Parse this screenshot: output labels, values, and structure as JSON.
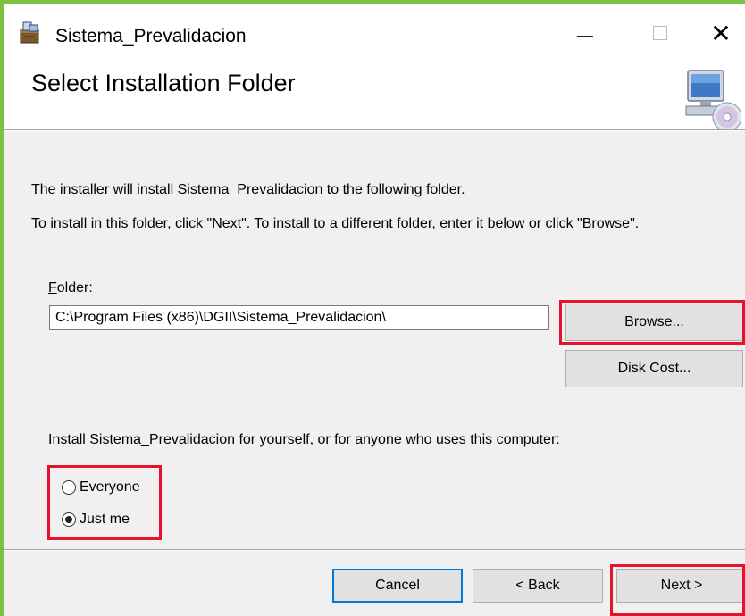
{
  "window": {
    "title": "Sistema_Prevalidacion",
    "minimize_glyph": "",
    "close_glyph": "✕",
    "app_icon": "installer-package-icon"
  },
  "header": {
    "title": "Select Installation Folder",
    "icon": "computer-disc-icon"
  },
  "body": {
    "description_1": "The installer will install Sistema_Prevalidacion to the following folder.",
    "description_2": "To install in this folder, click \"Next\". To install to a different folder, enter it below or click \"Browse\".",
    "folder_label_accel": "F",
    "folder_label_rest": "older:",
    "folder_value": "C:\\Program Files (x86)\\DGII\\Sistema_Prevalidacion\\",
    "browse_label": "Browse...",
    "disk_cost_label": "Disk Cost...",
    "install_for_text": "Install Sistema_Prevalidacion for yourself, or for anyone who uses this computer:",
    "radio_options": [
      {
        "label": "Everyone",
        "selected": false
      },
      {
        "label": "Just me",
        "selected": true
      }
    ]
  },
  "footer": {
    "cancel_label": "Cancel",
    "back_label": "< Back",
    "next_label": "Next >"
  },
  "colors": {
    "frame_accent": "#7cc242",
    "highlight": "#e8112d",
    "focus": "#0078d7"
  }
}
